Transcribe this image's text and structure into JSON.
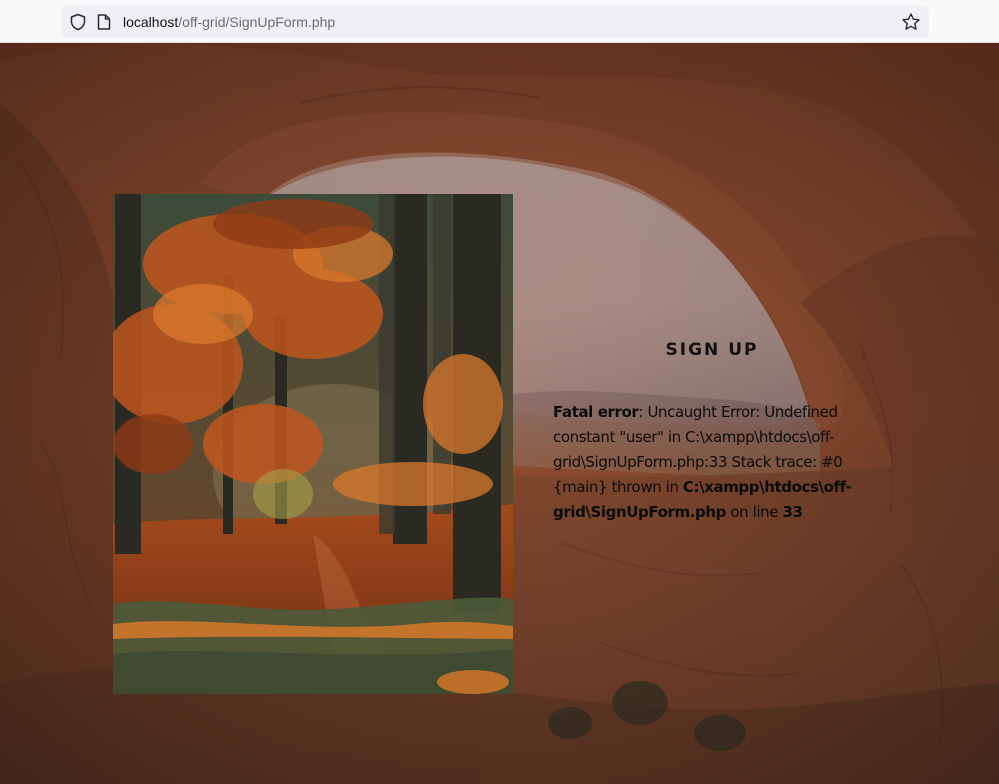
{
  "browser": {
    "url_host": "localhost",
    "url_path": "/off-grid/SignUpForm.php",
    "icons": [
      "shield-icon",
      "page-icon",
      "star-icon"
    ]
  },
  "signup": {
    "title": "SIGN UP"
  },
  "error": {
    "label": "Fatal error",
    "message": ": Uncaught Error: Undefined constant \"user\" in C:\\xampp\\htdocs\\off-grid\\SignUpForm.php:33 Stack trace: #0 {main} thrown in ",
    "file": "C:\\xampp\\htdocs\\off-grid\\SignUpForm.php",
    "on_line": " on line ",
    "line": "33"
  },
  "colors": {
    "rock": "#8a4a2c",
    "sky": "#d9dbe6",
    "foliage": "#b5521c"
  }
}
